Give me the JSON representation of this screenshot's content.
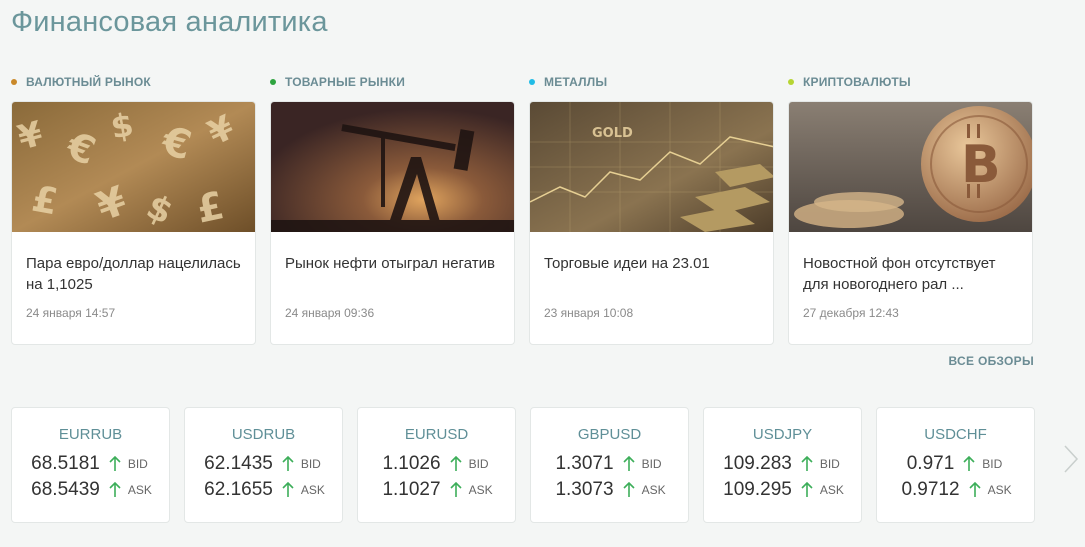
{
  "page": {
    "title": "Финансовая аналитика"
  },
  "reviews": [
    {
      "category": "ВАЛЮТНЫЙ РЫНОК",
      "dot_color": "#c9892a",
      "title": "Пара евро/доллар нацелилась на 1,1025",
      "date": "24 января 14:57",
      "image": "currency-symbols"
    },
    {
      "category": "ТОВАРНЫЕ РЫНКИ",
      "dot_color": "#2ea43f",
      "title": "Рынок нефти отыграл негатив",
      "date": "24 января 09:36",
      "image": "oil-pump"
    },
    {
      "category": "МЕТАЛЛЫ",
      "dot_color": "#21bce6",
      "title": "Торговые идеи на 23.01",
      "date": "23 января 10:08",
      "image": "gold-bars"
    },
    {
      "category": "КРИПТОВАЛЮТЫ",
      "dot_color": "#b6d533",
      "title": "Новостной фон отсутствует для новогоднего рал ...",
      "date": "27 декабря 12:43",
      "image": "bitcoin-coins"
    }
  ],
  "all_reviews_label": "ВСЕ ОБЗОРЫ",
  "quotes": [
    {
      "pair": "EURRUB",
      "bid": "68.5181",
      "ask": "68.5439",
      "bid_label": "BID",
      "ask_label": "ASK",
      "bid_dir": "up",
      "ask_dir": "up"
    },
    {
      "pair": "USDRUB",
      "bid": "62.1435",
      "ask": "62.1655",
      "bid_label": "BID",
      "ask_label": "ASK",
      "bid_dir": "up",
      "ask_dir": "up"
    },
    {
      "pair": "EURUSD",
      "bid": "1.1026",
      "ask": "1.1027",
      "bid_label": "BID",
      "ask_label": "ASK",
      "bid_dir": "up",
      "ask_dir": "up"
    },
    {
      "pair": "GBPUSD",
      "bid": "1.3071",
      "ask": "1.3073",
      "bid_label": "BID",
      "ask_label": "ASK",
      "bid_dir": "up",
      "ask_dir": "up"
    },
    {
      "pair": "USDJPY",
      "bid": "109.283",
      "ask": "109.295",
      "bid_label": "BID",
      "ask_label": "ASK",
      "bid_dir": "up",
      "ask_dir": "up"
    },
    {
      "pair": "USDCHF",
      "bid": "0.971",
      "ask": "0.9712",
      "bid_label": "BID",
      "ask_label": "ASK",
      "bid_dir": "up",
      "ask_dir": "up"
    }
  ],
  "colors": {
    "accent": "#6b969b",
    "up_arrow": "#3dae5a",
    "page_bg": "#f4f6f5"
  },
  "icons": {
    "up": "arrow-up-icon",
    "next": "chevron-right-icon"
  }
}
